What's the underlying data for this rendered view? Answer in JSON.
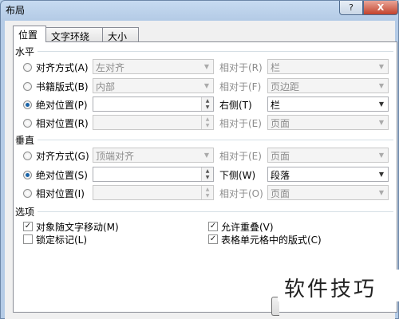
{
  "window": {
    "title": "布局",
    "help_label": "?",
    "close_label": "X"
  },
  "tabs": [
    "位置",
    "文字环绕",
    "大小"
  ],
  "horizontal": {
    "label": "水平",
    "rows": [
      {
        "option": "对齐方式(A)",
        "value": "左对齐",
        "relative_label": "相对于(R)",
        "relative_value": "栏",
        "checked": false,
        "enabled": false
      },
      {
        "option": "书籍版式(B)",
        "value": "内部",
        "relative_label": "相对于(F)",
        "relative_value": "页边距",
        "checked": false,
        "enabled": false
      },
      {
        "option": "绝对位置(P)",
        "value": "",
        "relative_label": "右侧(T)",
        "relative_value": "栏",
        "checked": true,
        "enabled": true
      },
      {
        "option": "相对位置(R)",
        "value": "",
        "relative_label": "相对于(E)",
        "relative_value": "页面",
        "checked": false,
        "enabled": false
      }
    ]
  },
  "vertical": {
    "label": "垂直",
    "rows": [
      {
        "option": "对齐方式(G)",
        "value": "顶端对齐",
        "relative_label": "相对于(E)",
        "relative_value": "页面",
        "checked": false,
        "enabled": false
      },
      {
        "option": "绝对位置(S)",
        "value": "",
        "relative_label": "下侧(W)",
        "relative_value": "段落",
        "checked": true,
        "enabled": true
      },
      {
        "option": "相对位置(I)",
        "value": "",
        "relative_label": "相对于(O)",
        "relative_value": "页面",
        "checked": false,
        "enabled": false
      }
    ]
  },
  "options": {
    "label": "选项",
    "items": [
      {
        "label": "对象随文字移动(M)",
        "checked": true
      },
      {
        "label": "锁定标记(L)",
        "checked": false
      },
      {
        "label": "允许重叠(V)",
        "checked": true
      },
      {
        "label": "表格单元格中的版式(C)",
        "checked": true
      }
    ]
  },
  "watermark": "软件技巧",
  "colors": {
    "accent": "#1a64a8",
    "panel_border": "#898c95",
    "title_bg": "#b4cbe6",
    "close_red": "#c2422c"
  }
}
